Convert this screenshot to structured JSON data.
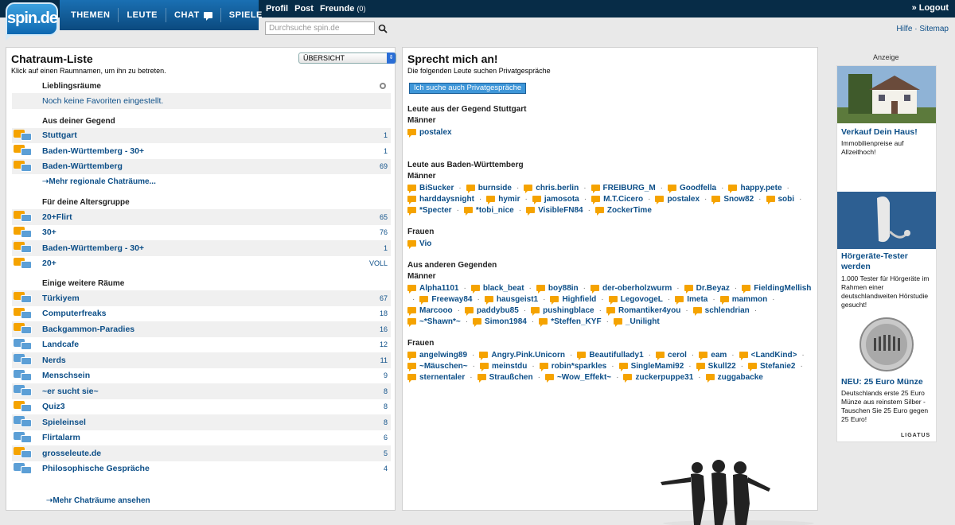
{
  "brand": {
    "logo_text": "spin.de"
  },
  "nav": {
    "themen": "THEMEN",
    "leute": "LEUTE",
    "chat": "CHAT",
    "spiele": "SPIELE"
  },
  "usernav": {
    "profil": "Profil",
    "post": "Post",
    "freunde": "Freunde",
    "freunde_count": "(0)",
    "logout": "» Logout"
  },
  "search": {
    "placeholder": "Durchsuche spin.de"
  },
  "help": {
    "hilfe": "Hilfe",
    "sep": "·",
    "sitemap": "Sitemap"
  },
  "left": {
    "title": "Chatraum-Liste",
    "subtitle": "Klick auf einen Raumnamen, um ihn zu betreten.",
    "select_value": "ÜBERSICHT",
    "favorites": {
      "heading": "Lieblingsräume",
      "empty": "Noch keine Favoriten eingestellt."
    },
    "region": {
      "heading": "Aus deiner Gegend",
      "rooms": [
        {
          "name": "Stuttgart",
          "count": "1"
        },
        {
          "name": "Baden-Württemberg - 30+",
          "count": "1"
        },
        {
          "name": "Baden-Württemberg",
          "count": "69"
        }
      ],
      "more": "➝Mehr regionale Chaträume..."
    },
    "age": {
      "heading": "Für deine Altersgruppe",
      "rooms": [
        {
          "name": "20+Flirt",
          "count": "65"
        },
        {
          "name": "30+",
          "count": "76"
        },
        {
          "name": "Baden-Württemberg - 30+",
          "count": "1"
        },
        {
          "name": "20+",
          "count": "VOLL"
        }
      ]
    },
    "other": {
      "heading": "Einige weitere Räume",
      "rooms": [
        {
          "name": "Türkiyem",
          "count": "67"
        },
        {
          "name": "Computerfreaks",
          "count": "18"
        },
        {
          "name": "Backgammon-Paradies",
          "count": "16"
        },
        {
          "name": "Landcafe",
          "count": "12"
        },
        {
          "name": "Nerds",
          "count": "11"
        },
        {
          "name": "Menschsein",
          "count": "9"
        },
        {
          "name": "~er sucht sie~",
          "count": "8"
        },
        {
          "name": "Quiz3",
          "count": "8"
        },
        {
          "name": "Spieleinsel",
          "count": "8"
        },
        {
          "name": "Flirtalarm",
          "count": "6"
        },
        {
          "name": "grosseleute.de",
          "count": "5"
        },
        {
          "name": "Philosophische Gespräche",
          "count": "4"
        }
      ]
    },
    "more_rooms": "➝Mehr Chaträume ansehen"
  },
  "mid": {
    "title": "Sprecht mich an!",
    "subtitle": "Die folgenden Leute suchen Privatgespräche",
    "button": "Ich suche auch Privatgespräche",
    "groups": [
      {
        "heading": "Leute aus der Gegend Stuttgart",
        "sections": [
          {
            "gender": "Männer",
            "users": [
              "postalex"
            ]
          }
        ]
      },
      {
        "heading": "Leute aus Baden-Württemberg",
        "sections": [
          {
            "gender": "Männer",
            "users": [
              "BiSucker",
              "burnside",
              "chris.berlin",
              "FREIBURG_M",
              "Goodfella",
              "happy.pete",
              "harddaysnight",
              "hymir",
              "jamosota",
              "M.T.Cicero",
              "postalex",
              "Snow82",
              "sobi",
              "*Specter",
              "*tobi_nice",
              "VisibleFN84",
              "ZockerTime"
            ]
          },
          {
            "gender": "Frauen",
            "users": [
              "Vio"
            ]
          }
        ]
      },
      {
        "heading": "Aus anderen Gegenden",
        "sections": [
          {
            "gender": "Männer",
            "users": [
              "Alpha1101",
              "black_beat",
              "boy88in",
              "der-oberholzwurm",
              "Dr.Beyaz",
              "FieldingMellish",
              "Freeway84",
              "hausgeist1",
              "Highfield",
              "LegovogeL",
              "Imeta",
              "mammon",
              "Marcooo",
              "paddybu85",
              "pushingblace",
              "Romantiker4you",
              "schlendrian",
              "~*Shawn*~",
              "Simon1984",
              "*Steffen_KYF",
              "_Unilight"
            ]
          },
          {
            "gender": "Frauen",
            "users": [
              "angelwing89",
              "Angry.Pink.Unicorn",
              "Beautifullady1",
              "cerol",
              "eam",
              "<LandKind>",
              "~Mäuschen~",
              "meinstdu",
              "robin*sparkles",
              "SingleMami92",
              "Skull22",
              "Stefanie2",
              "sternentaler",
              "Straußchen",
              "~Wow_Effekt~",
              "zuckerpuppe31",
              "zuggabacke"
            ]
          }
        ]
      }
    ]
  },
  "ad": {
    "label": "Anzeige",
    "items": [
      {
        "title": "Verkauf Dein Haus!",
        "desc": "Immobilienpreise auf Allzeithoch!"
      },
      {
        "title": "Hörgeräte-Tester werden",
        "desc": "1.000 Tester für Hörgeräte im Rahmen einer deutschlandweiten Hörstudie gesucht!"
      },
      {
        "title": "NEU: 25 Euro Münze",
        "desc": "Deutschlands erste 25 Euro Münze aus reinstem Silber - Tauschen Sie 25 Euro gegen 25 Euro!"
      }
    ],
    "brand": "LIGATUS"
  }
}
